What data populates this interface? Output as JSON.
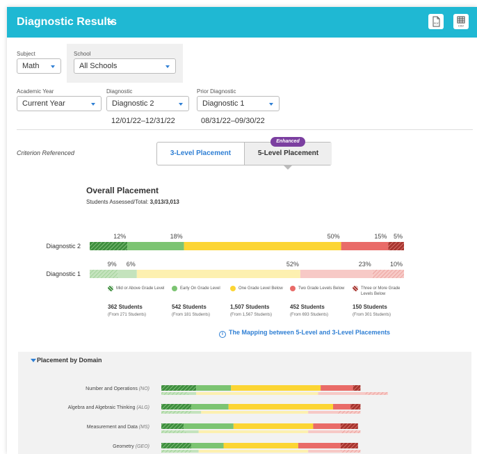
{
  "header": {
    "title": "Diagnostic Results",
    "pdf_label": "PDF",
    "csv_label": "CSV"
  },
  "filters": {
    "subject": {
      "label": "Subject",
      "value": "Math"
    },
    "school": {
      "label": "School",
      "value": "All Schools"
    },
    "academic_year": {
      "label": "Academic Year",
      "value": "Current Year"
    },
    "diagnostic": {
      "label": "Diagnostic",
      "value": "Diagnostic 2",
      "dates": "12/01/22–12/31/22"
    },
    "prior_diagnostic": {
      "label": "Prior Diagnostic",
      "value": "Diagnostic 1",
      "dates": "08/31/22–09/30/22"
    }
  },
  "criterion": "Criterion Referenced",
  "placement_tabs": {
    "three_level": "3-Level Placement",
    "five_level": "5-Level Placement",
    "enhanced_badge": "Enhanced"
  },
  "overall": {
    "title": "Overall Placement",
    "sub_label": "Students Assessed/Total: ",
    "sub_value": "3,013/3,013"
  },
  "colors": {
    "mid_above": "#3e8e3e",
    "early_on": "#7cc472",
    "one_below": "#fcd534",
    "two_below": "#e96b68",
    "three_below": "#a7352f"
  },
  "chart_data": {
    "type": "bar",
    "orientation": "horizontal-stacked",
    "categories": [
      "Diagnostic 2",
      "Diagnostic 1"
    ],
    "series": [
      {
        "name": "Mid or Above Grade Level",
        "values": [
          12,
          9
        ]
      },
      {
        "name": "Early On Grade Level",
        "values": [
          18,
          6
        ]
      },
      {
        "name": "One Grade Level Below",
        "values": [
          50,
          52
        ]
      },
      {
        "name": "Two Grade Levels Below",
        "values": [
          15,
          23
        ]
      },
      {
        "name": "Three or More Grade Levels Below",
        "values": [
          5,
          10
        ]
      }
    ],
    "value_labels": [
      [
        "12%",
        "18%",
        "50%",
        "15%",
        "5%"
      ],
      [
        "9%",
        "6%",
        "52%",
        "23%",
        "10%"
      ]
    ],
    "xlim": [
      0,
      100
    ]
  },
  "legend": [
    {
      "label": "Mid or Above Grade Level",
      "students": "362 Students",
      "from": "(From 271 Students)",
      "color": "#3e8e3e",
      "icon": "striped-dot"
    },
    {
      "label": "Early On Grade Level",
      "students": "542 Students",
      "from": "(From 181 Students)",
      "color": "#7cc472",
      "icon": "dot"
    },
    {
      "label": "One Grade Level Below",
      "students": "1,507 Students",
      "from": "(From 1,567 Students)",
      "color": "#fcd534",
      "icon": "dot"
    },
    {
      "label": "Two Grade Levels Below",
      "students": "452 Students",
      "from": "(From 693 Students)",
      "color": "#e96b68",
      "icon": "dot"
    },
    {
      "label": "Three or More Grade Levels Below",
      "students": "150 Students",
      "from": "(From 301 Students)",
      "color": "#a7352f",
      "icon": "striped-dot"
    }
  ],
  "mapping_link": "The Mapping between 5-Level and 3-Level Placements",
  "domain": {
    "title": "Placement by Domain",
    "rows": [
      {
        "name": "Number and Operations",
        "abbr": "(NO)",
        "current": [
          14,
          14,
          36,
          13,
          3
        ],
        "prior": [
          11,
          3,
          49,
          19,
          9
        ]
      },
      {
        "name": "Algebra and Algebraic Thinking",
        "abbr": "(ALG)",
        "current": [
          12,
          15,
          42,
          7,
          4
        ],
        "prior": [
          12,
          4,
          43,
          12,
          9
        ]
      },
      {
        "name": "Measurement and Data",
        "abbr": "(MS)",
        "current": [
          9,
          20,
          32,
          11,
          7
        ],
        "prior": [
          10,
          5,
          44,
          13,
          8
        ]
      },
      {
        "name": "Geometry",
        "abbr": "(GEO)",
        "current": [
          12,
          13,
          30,
          17,
          7
        ],
        "prior": [
          12,
          3,
          44,
          13,
          8
        ]
      }
    ]
  }
}
